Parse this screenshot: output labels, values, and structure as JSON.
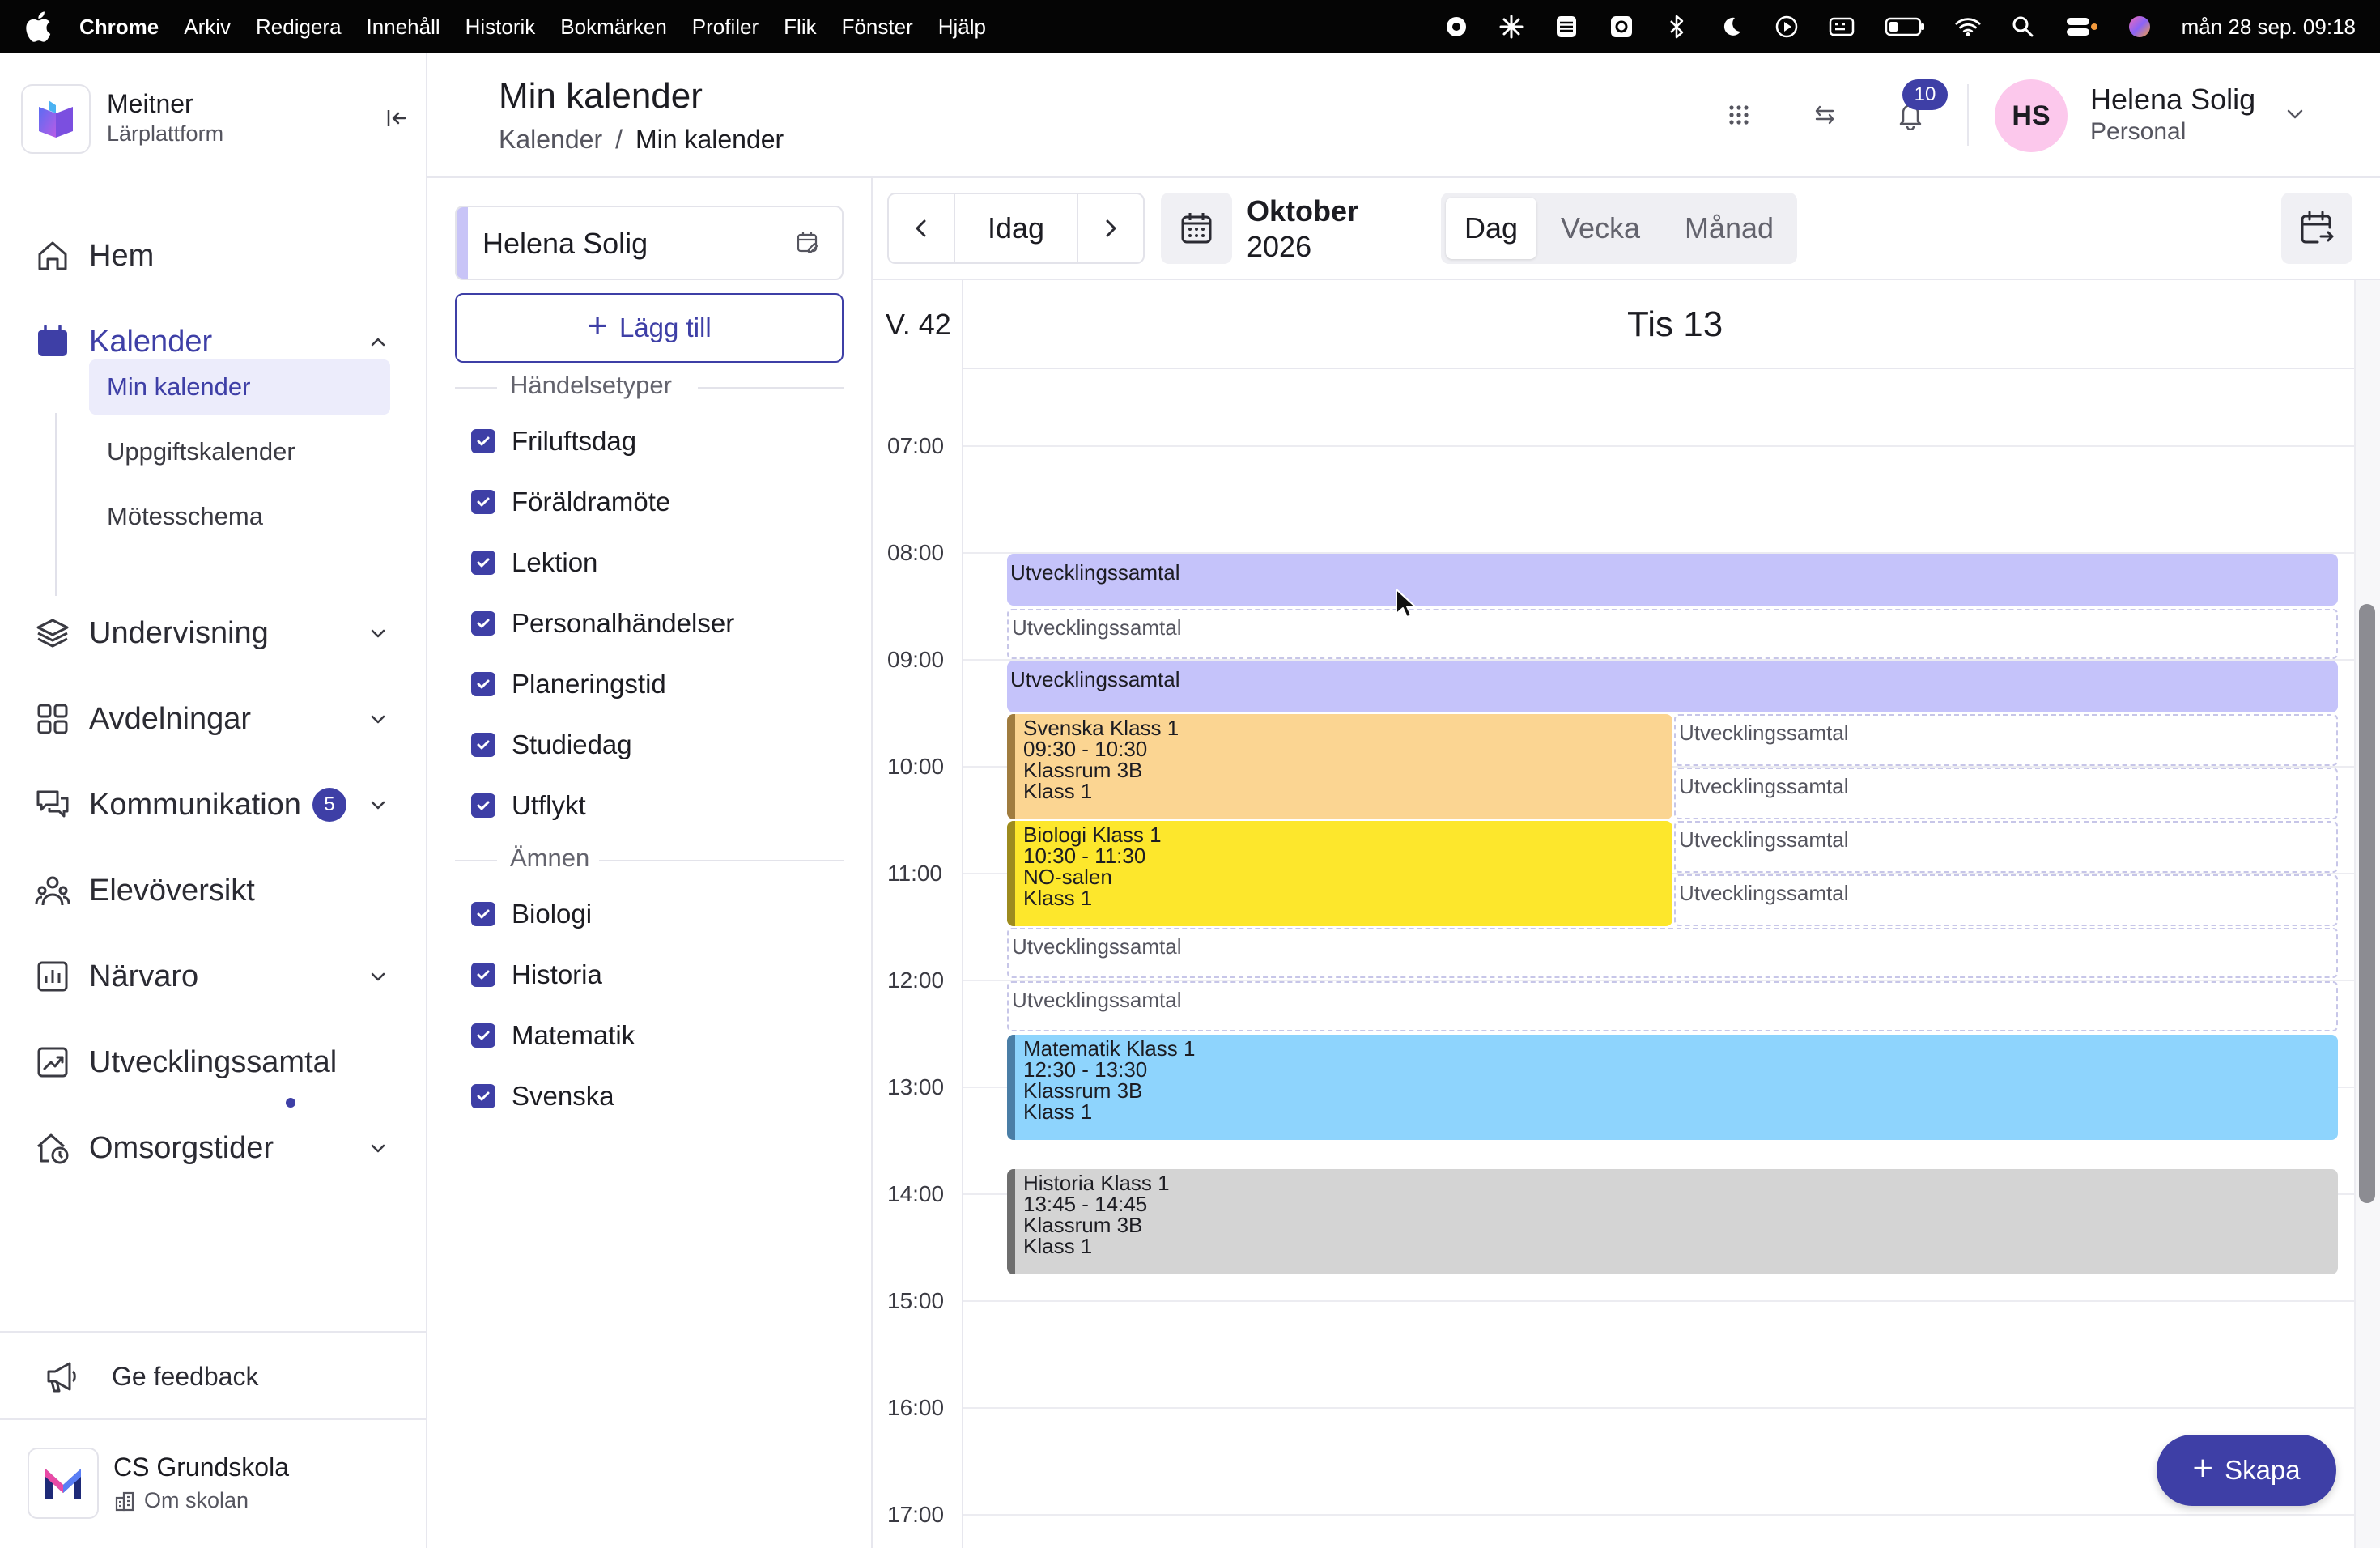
{
  "menubar": {
    "app": "Chrome",
    "menus": [
      "Arkiv",
      "Redigera",
      "Innehåll",
      "Historik",
      "Bokmärken",
      "Profiler",
      "Flik",
      "Fönster",
      "Hjälp"
    ],
    "clock": "mån 28 sep. 09:18"
  },
  "brand": {
    "name": "Meitner",
    "subtitle": "Lärplattform"
  },
  "nav": {
    "home": "Hem",
    "calendar": "Kalender",
    "calendar_sub": [
      "Min kalender",
      "Uppgiftskalender",
      "Mötesschema"
    ],
    "teaching": "Undervisning",
    "departments": "Avdelningar",
    "communication": "Kommunikation",
    "communication_badge": "5",
    "students": "Elevöversikt",
    "attendance": "Närvaro",
    "dev_talks": "Utvecklingssamtal",
    "care_times": "Omsorgstider"
  },
  "feedback": "Ge feedback",
  "school": {
    "name": "CS Grundskola",
    "link": "Om skolan"
  },
  "header": {
    "title": "Min kalender",
    "breadcrumb": {
      "root": "Kalender",
      "sep": "/",
      "current": "Min kalender"
    },
    "notifications": "10",
    "user": {
      "initials": "HS",
      "name": "Helena Solig",
      "role": "Personal"
    }
  },
  "filters": {
    "person": "Helena Solig",
    "add_label": "Lägg till",
    "event_types_title": "Händelsetyper",
    "event_types": [
      "Friluftsdag",
      "Föräldramöte",
      "Lektion",
      "Personalhändelser",
      "Planeringstid",
      "Studiedag",
      "Utflykt"
    ],
    "subjects_title": "Ämnen",
    "subjects": [
      "Biologi",
      "Historia",
      "Matematik",
      "Svenska"
    ]
  },
  "toolbar": {
    "today": "Idag",
    "month": "Oktober",
    "year": "2026",
    "views": [
      "Dag",
      "Vecka",
      "Månad"
    ],
    "selected_view": "Dag"
  },
  "calendar": {
    "week": "V. 42",
    "day": "Tis 13",
    "hours": [
      "07:00",
      "08:00",
      "09:00",
      "10:00",
      "11:00",
      "12:00",
      "13:00",
      "14:00",
      "15:00",
      "16:00",
      "17:00"
    ],
    "events": [
      {
        "kind": "uv",
        "title": "Utvecklingssamtal"
      },
      {
        "kind": "uvd",
        "title": "Utvecklingssamtal"
      },
      {
        "kind": "uv",
        "title": "Utvecklingssamtal"
      },
      {
        "kind": "lesson",
        "lines": [
          "Svenska Klass 1",
          "09:30 - 10:30",
          "Klassrum 3B",
          "Klass 1"
        ],
        "color": "#fbd592",
        "stripe": "#a07c3f"
      },
      {
        "kind": "uvd",
        "title": "Utvecklingssamtal"
      },
      {
        "kind": "uvd",
        "title": "Utvecklingssamtal"
      },
      {
        "kind": "lesson",
        "lines": [
          "Biologi Klass 1",
          "10:30 - 11:30",
          "NO-salen",
          "Klass 1"
        ],
        "color": "#fde72c",
        "stripe": "#9d8b1f"
      },
      {
        "kind": "uvd",
        "title": "Utvecklingssamtal"
      },
      {
        "kind": "uvd",
        "title": "Utvecklingssamtal"
      },
      {
        "kind": "uvd",
        "title": "Utvecklingssamtal"
      },
      {
        "kind": "uvd",
        "title": "Utvecklingssamtal"
      },
      {
        "kind": "lesson",
        "lines": [
          "Matematik Klass 1",
          "12:30 - 13:30",
          "Klassrum 3B",
          "Klass 1"
        ],
        "color": "#8ed4fd",
        "stripe": "#4a7ea6"
      },
      {
        "kind": "lesson",
        "lines": [
          "Historia Klass 1",
          "13:45 - 14:45",
          "Klassrum 3B",
          "Klass 1"
        ],
        "color": "#d4d4d4",
        "stripe": "#6e6e6e"
      }
    ]
  },
  "fab": "Skapa",
  "colors": {
    "accent": "#3e3fa6",
    "event_purple": "#c5c3fa"
  }
}
